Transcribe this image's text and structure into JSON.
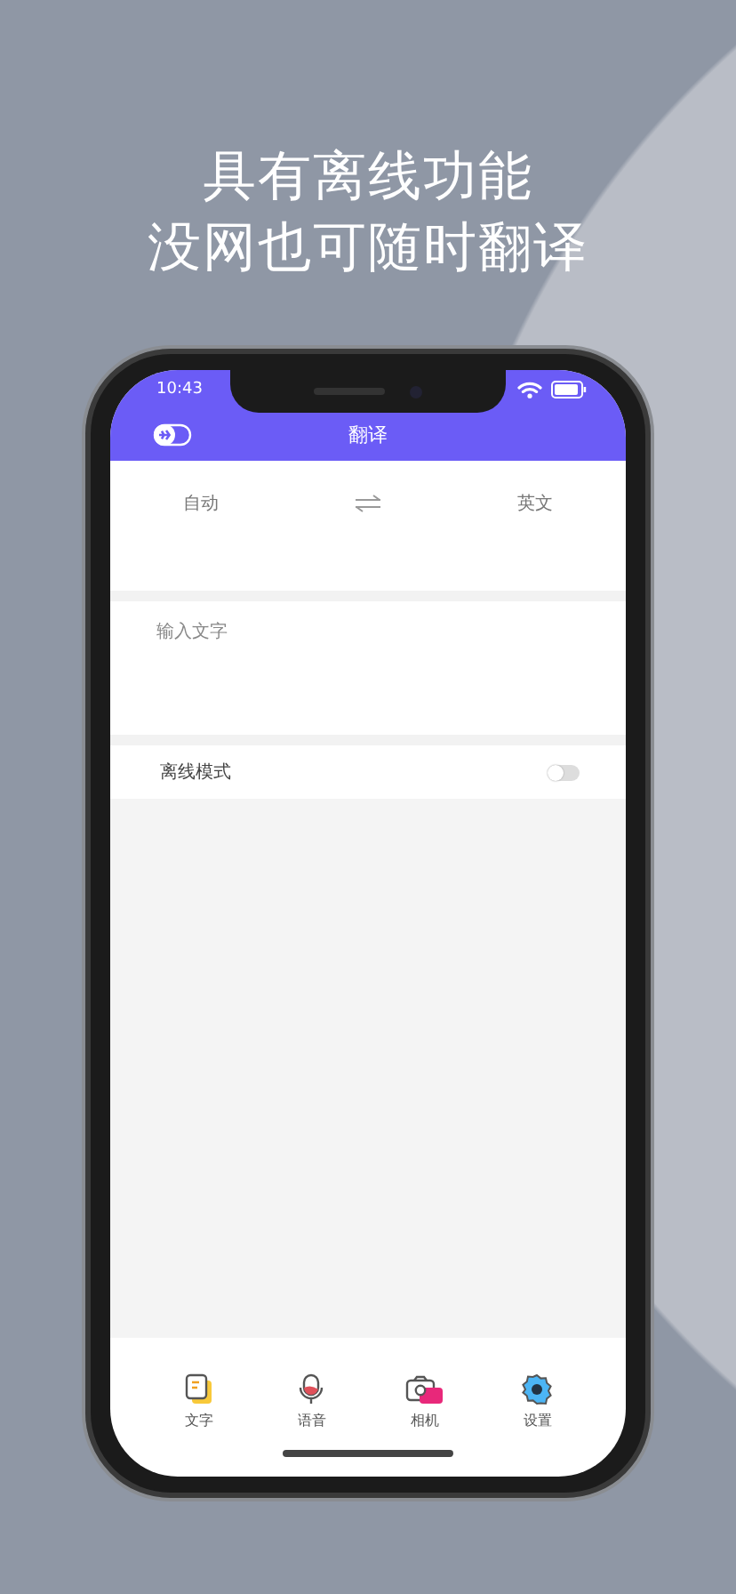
{
  "headline": [
    "具有离线功能",
    "没网也可随时翻译"
  ],
  "status_bar": {
    "time": "10:43"
  },
  "nav": {
    "title": "翻译"
  },
  "languages": {
    "source": "自动",
    "target": "英文"
  },
  "input": {
    "placeholder": "输入文字"
  },
  "offline_mode": {
    "label": "离线模式",
    "on": false
  },
  "tabs": [
    {
      "label": "文字",
      "kind": "text"
    },
    {
      "label": "语音",
      "kind": "voice"
    },
    {
      "label": "相机",
      "kind": "camera"
    },
    {
      "label": "设置",
      "kind": "settings"
    }
  ]
}
